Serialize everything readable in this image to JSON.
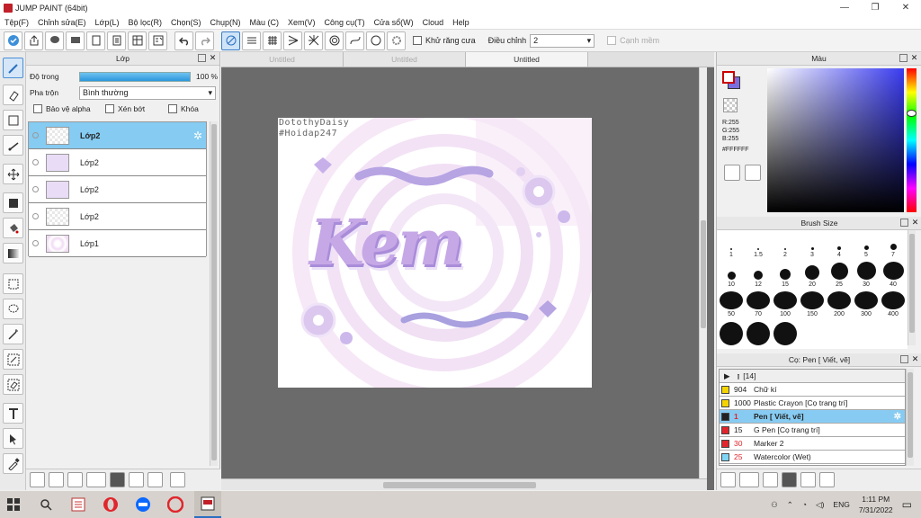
{
  "window": {
    "title": "JUMP PAINT (64bit)",
    "minimize": "—",
    "maximize": "❐",
    "close": "✕"
  },
  "menu": [
    "Tệp(F)",
    "Chỉnh sửa(E)",
    "Lớp(L)",
    "Bộ lọc(R)",
    "Chọn(S)",
    "Chụp(N)",
    "Màu (C)",
    "Xem(V)",
    "Công cụ(T)",
    "Cửa sổ(W)",
    "Cloud",
    "Help"
  ],
  "toolbar": {
    "antialias_label": "Khử răng cưa",
    "adjust_label": "Điều chỉnh",
    "adjust_value": "2",
    "edge_label": "Cạnh mềm"
  },
  "layer_panel": {
    "title": "Lớp",
    "opacity_label": "Độ trong",
    "opacity_value": "100 %",
    "opacity_level": 1.0,
    "blend_label": "Pha trộn",
    "blend_value": "Bình thường",
    "protect_alpha": "Bảo vệ alpha",
    "clipping": "Xén bớt",
    "lock": "Khóa",
    "layers": [
      {
        "name": "Lớp2",
        "selected": true
      },
      {
        "name": "Lớp2",
        "selected": false
      },
      {
        "name": "Lớp2",
        "selected": false
      },
      {
        "name": "Lớp2",
        "selected": false
      },
      {
        "name": "Lớp1",
        "selected": false
      }
    ]
  },
  "doc_tabs": [
    "Untitled",
    "Untitled",
    "Untitled"
  ],
  "artwork": {
    "credit_line1": "DotothyDaisy",
    "credit_line2": "#Hoidap247",
    "word": "Kem"
  },
  "color_panel": {
    "title": "Màu",
    "r": "R:255",
    "g": "G:255",
    "b": "B:255",
    "hex": "#FFFFFF",
    "main_color": "#ffffff",
    "sub_color": "#7b6fe0"
  },
  "brush_size_panel": {
    "title": "Brush Size",
    "sizes": [
      "1",
      "1.5",
      "2",
      "3",
      "4",
      "5",
      "7",
      "10",
      "12",
      "15",
      "20",
      "25",
      "30",
      "40",
      "50",
      "70",
      "100",
      "150",
      "200",
      "300",
      "400",
      "",
      "",
      ""
    ]
  },
  "brush_panel": {
    "title": "Cọ: Pen [ Viết, vẽ]",
    "folder": "[14]",
    "items": [
      {
        "size": "904",
        "name": "Chữ kí",
        "color": "#f4d400",
        "sizecolor": "#222",
        "selected": false
      },
      {
        "size": "1000",
        "name": "Plastic Crayon [Cọ trang trí]",
        "color": "#f4d400",
        "sizecolor": "#222",
        "selected": false
      },
      {
        "size": "1",
        "name": "Pen [ Viết, vẽ]",
        "color": "#222222",
        "sizecolor": "#e0262c",
        "selected": true
      },
      {
        "size": "15",
        "name": "G Pen [Cọ trang trí]",
        "color": "#e0262c",
        "sizecolor": "#222",
        "selected": false
      },
      {
        "size": "30",
        "name": "Marker 2",
        "color": "#e0262c",
        "sizecolor": "#e0262c",
        "selected": false
      },
      {
        "size": "25",
        "name": "Watercolor (Wet)",
        "color": "#7fd6f4",
        "sizecolor": "#e0262c",
        "selected": false
      }
    ]
  },
  "taskbar": {
    "lang": "ENG",
    "time": "1:11 PM",
    "date": "7/31/2022"
  }
}
